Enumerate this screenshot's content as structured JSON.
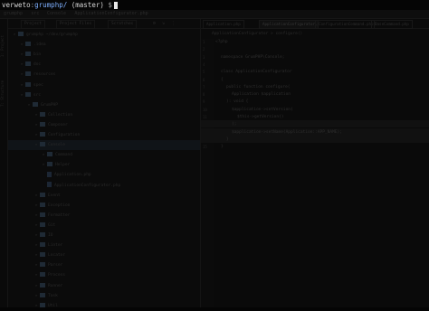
{
  "terminal": {
    "user": "verweto",
    "path": "grumphp/",
    "branch": "(master)",
    "prompt_symbol": "$"
  },
  "ide": {
    "top_tabs": [
      "grumphp",
      "src",
      "Console",
      "ApplicationConfigurator.php"
    ],
    "side_strip": [
      "1: Project",
      "7: Structure"
    ],
    "project_panel": {
      "tabs": [
        "Project",
        "Project Files",
        "Scratches"
      ],
      "tree": [
        {
          "label": "grumphp ~/dev/grumphp",
          "depth": 0,
          "type": "folder"
        },
        {
          "label": ".idea",
          "depth": 1,
          "type": "folder"
        },
        {
          "label": "bin",
          "depth": 1,
          "type": "folder"
        },
        {
          "label": "doc",
          "depth": 1,
          "type": "folder"
        },
        {
          "label": "resources",
          "depth": 1,
          "type": "folder"
        },
        {
          "label": "spec",
          "depth": 1,
          "type": "folder"
        },
        {
          "label": "src",
          "depth": 1,
          "type": "folder"
        },
        {
          "label": "GrumPHP",
          "depth": 2,
          "type": "folder"
        },
        {
          "label": "Collection",
          "depth": 3,
          "type": "folder"
        },
        {
          "label": "Composer",
          "depth": 3,
          "type": "folder"
        },
        {
          "label": "Configuration",
          "depth": 3,
          "type": "folder"
        },
        {
          "label": "Console",
          "depth": 3,
          "type": "folder",
          "selected": true
        },
        {
          "label": "Command",
          "depth": 4,
          "type": "folder"
        },
        {
          "label": "Helper",
          "depth": 4,
          "type": "folder"
        },
        {
          "label": "Application.php",
          "depth": 4,
          "type": "file"
        },
        {
          "label": "ApplicationConfigurator.php",
          "depth": 4,
          "type": "file"
        },
        {
          "label": "Event",
          "depth": 3,
          "type": "folder"
        },
        {
          "label": "Exception",
          "depth": 3,
          "type": "folder"
        },
        {
          "label": "Formatter",
          "depth": 3,
          "type": "folder"
        },
        {
          "label": "Git",
          "depth": 3,
          "type": "folder"
        },
        {
          "label": "IO",
          "depth": 3,
          "type": "folder"
        },
        {
          "label": "Linter",
          "depth": 3,
          "type": "folder"
        },
        {
          "label": "Locator",
          "depth": 3,
          "type": "folder"
        },
        {
          "label": "Parser",
          "depth": 3,
          "type": "folder"
        },
        {
          "label": "Process",
          "depth": 3,
          "type": "folder"
        },
        {
          "label": "Runner",
          "depth": 3,
          "type": "folder"
        },
        {
          "label": "Task",
          "depth": 3,
          "type": "folder"
        },
        {
          "label": "Util",
          "depth": 3,
          "type": "folder"
        }
      ]
    },
    "editor": {
      "tabs": [
        {
          "label": "Application.php",
          "active": false
        },
        {
          "label": "ApplicationConfigurator.php",
          "active": true
        },
        {
          "label": "ConfigurationCommand.php",
          "active": false
        },
        {
          "label": "BaseCommand.php",
          "active": false
        }
      ],
      "breadcrumb": "ApplicationConfigurator > configure()",
      "lines": [
        {
          "n": "1",
          "text": "<?php",
          "indent": 0
        },
        {
          "n": "2",
          "text": "",
          "indent": 0
        },
        {
          "n": "3",
          "text": "namespace GrumPHP\\Console;",
          "indent": 1
        },
        {
          "n": "4",
          "text": "",
          "indent": 0
        },
        {
          "n": "5",
          "text": "class ApplicationConfigurator",
          "indent": 1
        },
        {
          "n": "6",
          "text": "{",
          "indent": 1
        },
        {
          "n": "7",
          "text": "public function configure(",
          "indent": 2
        },
        {
          "n": "8",
          "text": "Application $application",
          "indent": 3
        },
        {
          "n": "9",
          "text": "): void {",
          "indent": 2
        },
        {
          "n": "10",
          "text": "$application->setVersion(",
          "indent": 3
        },
        {
          "n": "11",
          "text": "$this->getVersion()",
          "indent": 4
        },
        {
          "n": "12",
          "text": ");",
          "indent": 3
        },
        {
          "n": "13",
          "text": "$application->setName(Application::APP_NAME);",
          "indent": 3
        },
        {
          "n": "14",
          "text": "}",
          "indent": 2
        },
        {
          "n": "15",
          "text": "}",
          "indent": 1
        }
      ]
    }
  }
}
